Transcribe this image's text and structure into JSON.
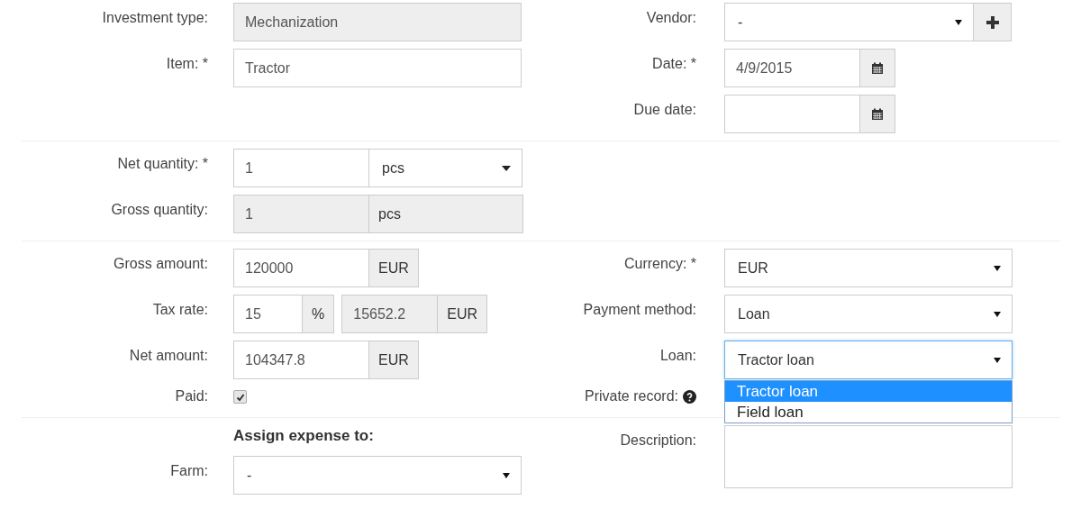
{
  "sections": [
    {
      "left": [
        {
          "label": "Investment type:",
          "kind": "text",
          "value": "Mechanization",
          "readonly": true
        },
        {
          "label": "Item: *",
          "kind": "text",
          "value": "Tractor",
          "readonly": false
        }
      ],
      "right": [
        {
          "label": "Vendor:",
          "kind": "select-plus",
          "value": "-"
        },
        {
          "label": "Date: *",
          "kind": "date",
          "value": "4/9/2015"
        },
        {
          "label": "Due date:",
          "kind": "date"
        }
      ]
    },
    {
      "left": [
        {
          "label": "Net quantity: *",
          "kind": "qty-select",
          "value": "1",
          "unit": "pcs"
        },
        {
          "label": "Gross quantity:",
          "kind": "addon",
          "value": "1",
          "addon": "pcs",
          "readonly": true
        }
      ]
    },
    {
      "left": [
        {
          "label": "Gross amount:",
          "kind": "addon",
          "value": "120000",
          "addon": "EUR",
          "readonly": false
        },
        {
          "label": "Tax rate:",
          "kind": "tax",
          "value": "15",
          "addon": "%",
          "amount": "15652.2",
          "amount_addon": "EUR"
        },
        {
          "label": "Net amount:",
          "kind": "addon",
          "value": "104347.8",
          "addon": "EUR",
          "readonly": false
        },
        {
          "label": "Paid:",
          "kind": "checkbox",
          "checked": true
        }
      ],
      "right": [
        {
          "label": "Currency: *",
          "kind": "select",
          "value": "EUR"
        },
        {
          "label": "Payment method:",
          "kind": "select",
          "value": "Loan"
        },
        {
          "label": "Loan:",
          "kind": "select",
          "value": "Tractor loan",
          "options": [
            {
              "label": "Tractor loan",
              "selected": true
            },
            {
              "label": "Field loan",
              "selected": false
            }
          ]
        },
        {
          "label": "Private record:",
          "kind": "help-label"
        }
      ]
    },
    {
      "left": [
        {
          "kind": "heading",
          "text": "Assign expense to:"
        },
        {
          "label": "Farm:",
          "kind": "select",
          "value": "-"
        }
      ],
      "right": [
        {
          "label": "Description:",
          "kind": "textarea"
        }
      ]
    }
  ]
}
